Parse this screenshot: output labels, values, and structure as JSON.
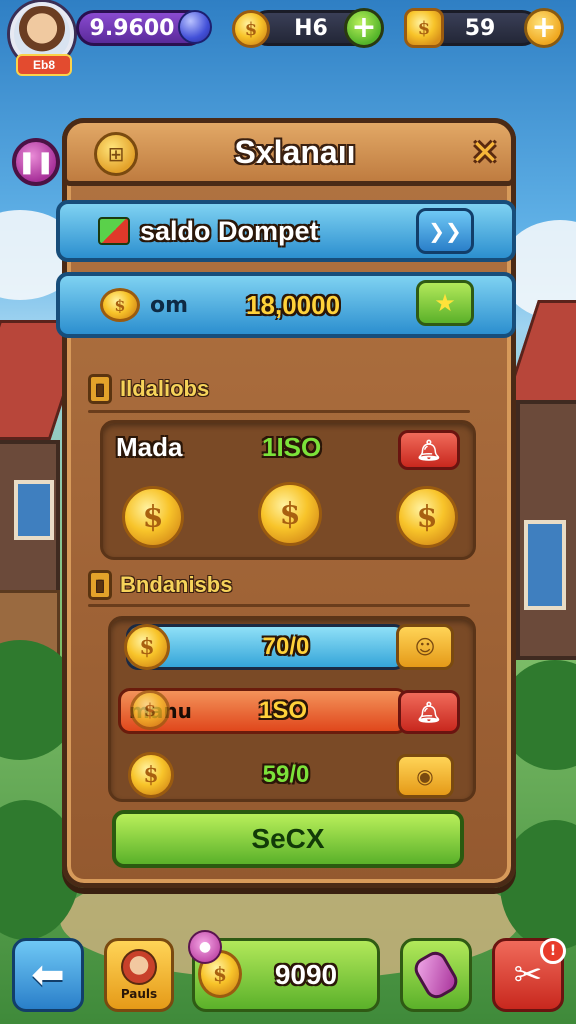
{
  "hud": {
    "gems": "9.9600",
    "energy": "H6",
    "coins": "59"
  },
  "avatar_tag": "Eb8",
  "panel": {
    "title": "Sxlanaıı",
    "wallet_label": "saldo Dompet",
    "balance_prefix": "om",
    "balance_value": "18,0000"
  },
  "section1": {
    "title": "Ildaliobs",
    "item_label": "Mada",
    "item_value": "1ISO"
  },
  "section2": {
    "title": "Bndanisbs",
    "rows": [
      {
        "value": "70/0"
      },
      {
        "label": "manu",
        "value": "1SO"
      },
      {
        "value": "59/0"
      }
    ]
  },
  "confirm_label": "SeCX",
  "bottom": {
    "profile_label": "Pauls",
    "shop_value": "9090"
  },
  "icons": {
    "pause": "pause-icon",
    "close": "close-icon",
    "back": "back-arrow-icon",
    "tools": "tools-icon"
  },
  "colors": {
    "panel": "#a86a3a",
    "bar_blue": "#2c8fcf",
    "confirm_green": "#5ab12a",
    "accent_gold": "#f8c42a"
  }
}
